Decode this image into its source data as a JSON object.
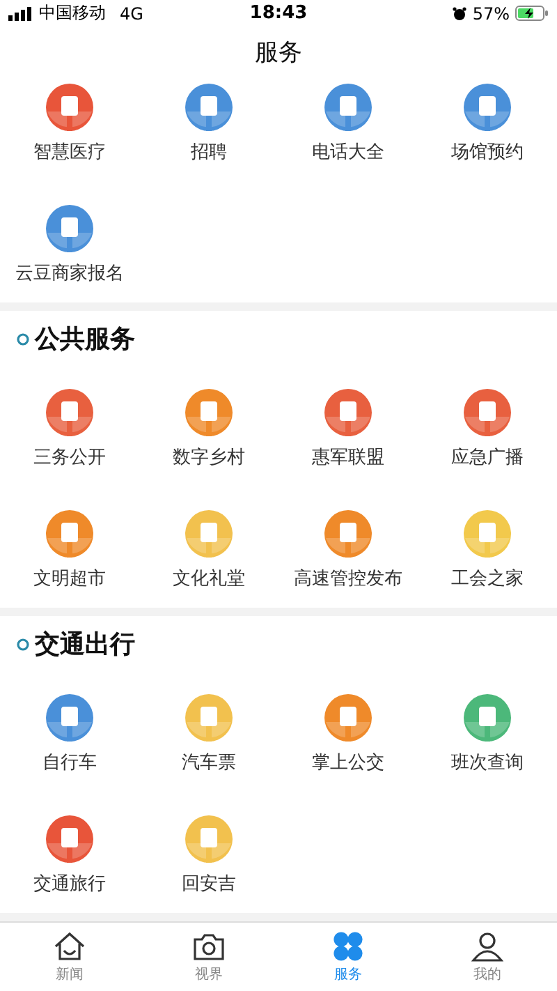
{
  "status_bar": {
    "carrier": "中国移动",
    "network": "4G",
    "time": "18:43",
    "battery": "57%"
  },
  "title": "服务",
  "top_services": [
    {
      "label": "智慧医疗",
      "color": "#e8553a"
    },
    {
      "label": "招聘",
      "color": "#4a90d9"
    },
    {
      "label": "电话大全",
      "color": "#4a90d9"
    },
    {
      "label": "场馆预约",
      "color": "#4a90d9"
    },
    {
      "label": "云豆商家报名",
      "color": "#4a90d9"
    }
  ],
  "sections": [
    {
      "heading": "公共服务",
      "items": [
        {
          "label": "三务公开",
          "color": "#e8603f"
        },
        {
          "label": "数字乡村",
          "color": "#ef8a2a"
        },
        {
          "label": "惠军联盟",
          "color": "#e8603f"
        },
        {
          "label": "应急广播",
          "color": "#e8603f"
        },
        {
          "label": "文明超市",
          "color": "#ef8a2a"
        },
        {
          "label": "文化礼堂",
          "color": "#f2c14e"
        },
        {
          "label": "高速管控发布",
          "color": "#ef8a2a"
        },
        {
          "label": "工会之家",
          "color": "#f2c94c"
        }
      ]
    },
    {
      "heading": "交通出行",
      "items": [
        {
          "label": "自行车",
          "color": "#4a90d9"
        },
        {
          "label": "汽车票",
          "color": "#f2c14e"
        },
        {
          "label": "掌上公交",
          "color": "#ef8a2a"
        },
        {
          "label": "班次查询",
          "color": "#4cb87a"
        },
        {
          "label": "交通旅行",
          "color": "#e8553a"
        },
        {
          "label": "回安吉",
          "color": "#f2c14e"
        }
      ]
    }
  ],
  "tabs": [
    {
      "label": "新闻",
      "selected": false
    },
    {
      "label": "视界",
      "selected": false
    },
    {
      "label": "服务",
      "selected": true
    },
    {
      "label": "我的",
      "selected": false
    }
  ]
}
